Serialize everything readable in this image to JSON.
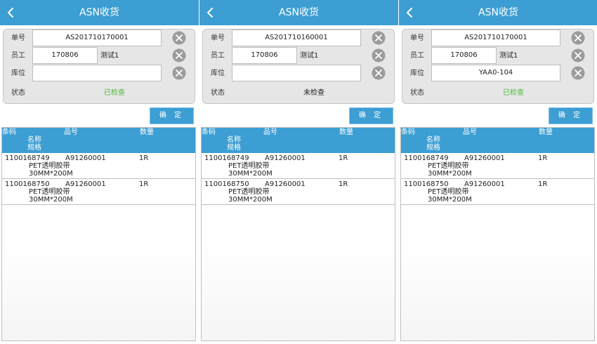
{
  "screens": [
    {
      "header": {
        "title": "ASN收货"
      },
      "form": {
        "order_label": "单号",
        "order_value": "AS201710170001",
        "employee_label": "员工",
        "employee_value": "170806",
        "employee_name": "测试1",
        "location_label": "库位",
        "location_value": "",
        "status_label": "状态",
        "status_value": "已检查",
        "status_color": "#52b83a"
      },
      "confirm_label": "确 定",
      "table": {
        "headers": {
          "barcode": "条码",
          "part_no": "品号",
          "qty": "数量",
          "name": "名称",
          "spec": "规格"
        },
        "rows": [
          {
            "barcode": "1100168749",
            "part_no": "A91260001",
            "qty": "1R",
            "name": "PET透明胶带",
            "spec": "30MM*200M"
          },
          {
            "barcode": "1100168750",
            "part_no": "A91260001",
            "qty": "1R",
            "name": "PET透明胶带",
            "spec": "30MM*200M"
          }
        ]
      }
    },
    {
      "header": {
        "title": "ASN收货"
      },
      "form": {
        "order_label": "单号",
        "order_value": "AS201710160001",
        "employee_label": "员工",
        "employee_value": "170806",
        "employee_name": "测试1",
        "location_label": "库位",
        "location_value": "",
        "status_label": "状态",
        "status_value": "未检查",
        "status_color": "#222222"
      },
      "confirm_label": "确 定",
      "table": {
        "headers": {
          "barcode": "条码",
          "part_no": "品号",
          "qty": "数量",
          "name": "名称",
          "spec": "规格"
        },
        "rows": [
          {
            "barcode": "1100168749",
            "part_no": "A91260001",
            "qty": "1R",
            "name": "PET透明胶带",
            "spec": "30MM*200M"
          },
          {
            "barcode": "1100168750",
            "part_no": "A91260001",
            "qty": "1R",
            "name": "PET透明胶带",
            "spec": "30MM*200M"
          }
        ]
      }
    },
    {
      "header": {
        "title": "ASN收货"
      },
      "form": {
        "order_label": "单号",
        "order_value": "AS201710170001",
        "employee_label": "员工",
        "employee_value": "170806",
        "employee_name": "测试1",
        "location_label": "库位",
        "location_value": "YAA0-104",
        "status_label": "状态",
        "status_value": "已检查",
        "status_color": "#52b83a"
      },
      "confirm_label": "确 定",
      "table": {
        "headers": {
          "barcode": "条码",
          "part_no": "品号",
          "qty": "数量",
          "name": "名称",
          "spec": "规格"
        },
        "rows": [
          {
            "barcode": "1100168749",
            "part_no": "A91260001",
            "qty": "1R",
            "name": "PET透明胶带",
            "spec": "30MM*200M"
          },
          {
            "barcode": "1100168750",
            "part_no": "A91260001",
            "qty": "1R",
            "name": "PET透明胶带",
            "spec": "30MM*200M"
          }
        ]
      }
    }
  ],
  "icons": {
    "back": "chevron-left-icon",
    "clear": "clear-circle-x-icon"
  },
  "colors": {
    "header_bg": "#3d9ed3",
    "button_bg": "#3d9ed3",
    "form_bg": "#e6e6e6",
    "checked_green": "#52b83a"
  }
}
